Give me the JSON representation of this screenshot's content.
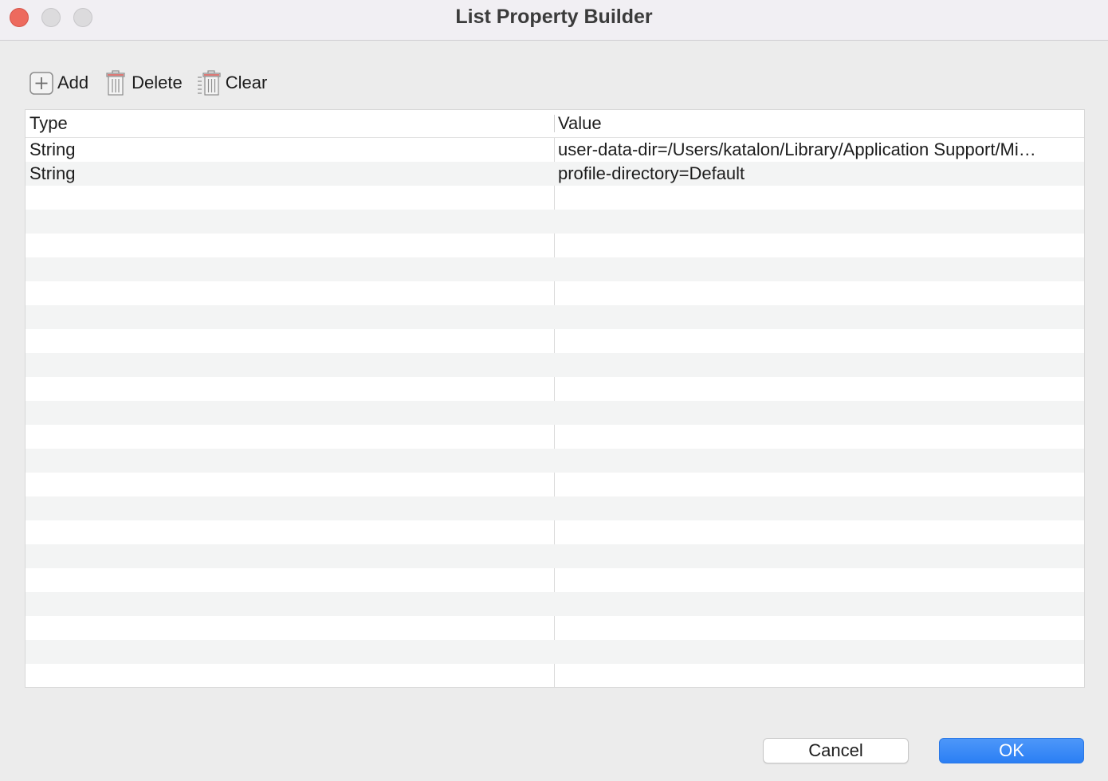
{
  "window": {
    "title": "List Property Builder"
  },
  "toolbar": {
    "add_label": "Add",
    "delete_label": "Delete",
    "clear_label": "Clear"
  },
  "table": {
    "columns": {
      "type": "Type",
      "value": "Value"
    },
    "rows": [
      {
        "type": "String",
        "value": "user-data-dir=/Users/katalon/Library/Application Support/Mi…"
      },
      {
        "type": "String",
        "value": "profile-directory=Default"
      },
      {
        "type": "",
        "value": ""
      },
      {
        "type": "",
        "value": ""
      },
      {
        "type": "",
        "value": ""
      },
      {
        "type": "",
        "value": ""
      },
      {
        "type": "",
        "value": ""
      },
      {
        "type": "",
        "value": ""
      },
      {
        "type": "",
        "value": ""
      },
      {
        "type": "",
        "value": ""
      },
      {
        "type": "",
        "value": ""
      },
      {
        "type": "",
        "value": ""
      },
      {
        "type": "",
        "value": ""
      },
      {
        "type": "",
        "value": ""
      },
      {
        "type": "",
        "value": ""
      },
      {
        "type": "",
        "value": ""
      },
      {
        "type": "",
        "value": ""
      },
      {
        "type": "",
        "value": ""
      },
      {
        "type": "",
        "value": ""
      },
      {
        "type": "",
        "value": ""
      },
      {
        "type": "",
        "value": ""
      },
      {
        "type": "",
        "value": ""
      },
      {
        "type": "",
        "value": ""
      },
      {
        "type": "",
        "value": ""
      }
    ]
  },
  "buttons": {
    "cancel_label": "Cancel",
    "ok_label": "OK"
  },
  "icons": {
    "add": "plus-square-icon",
    "delete": "trash-icon",
    "clear": "clear-list-icon"
  },
  "colors": {
    "accent": "#2b7ff4",
    "close": "#ed6a5e"
  }
}
